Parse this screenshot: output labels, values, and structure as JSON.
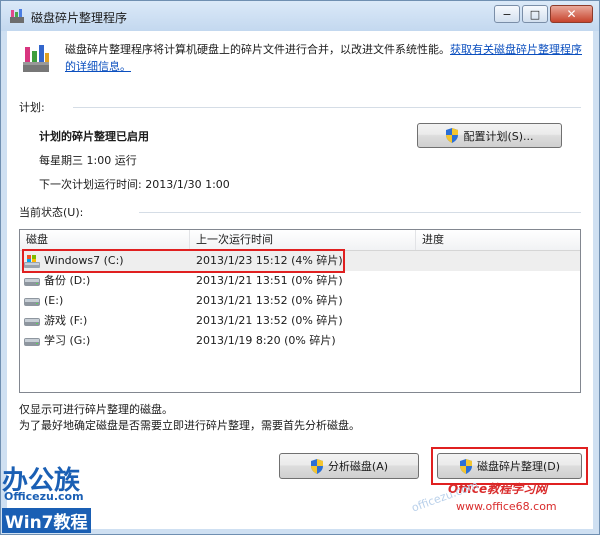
{
  "window": {
    "title": "磁盘碎片整理程序",
    "buttons": {
      "minimize": "−",
      "maximize": "□",
      "close": "✕"
    }
  },
  "intro": {
    "text": "磁盘碎片整理程序将计算机硬盘上的碎片文件进行合并，以改进文件系统性能。",
    "link": "获取有关磁盘碎片整理程序的详细信息。"
  },
  "schedule": {
    "group_label": "计划:",
    "status": "计划的碎片整理已启用",
    "run_time": "每星期三  1:00 运行",
    "next_run": "下一次计划运行时间: 2013/1/30 1:00",
    "configure_button": "配置计划(S)..."
  },
  "current": {
    "group_label": "当前状态(U):",
    "columns": [
      "磁盘",
      "上一次运行时间",
      "进度"
    ],
    "rows": [
      {
        "disk": "Windows7 (C:)",
        "last_run": "2013/1/23 15:12 (4% 碎片)",
        "progress": "",
        "type": "system"
      },
      {
        "disk": "备份 (D:)",
        "last_run": "2013/1/21 13:51 (0% 碎片)",
        "progress": "",
        "type": "drive"
      },
      {
        "disk": "(E:)",
        "last_run": "2013/1/21 13:52 (0% 碎片)",
        "progress": "",
        "type": "drive"
      },
      {
        "disk": "游戏 (F:)",
        "last_run": "2013/1/21 13:52 (0% 碎片)",
        "progress": "",
        "type": "drive"
      },
      {
        "disk": "学习 (G:)",
        "last_run": "2013/1/19 8:20 (0% 碎片)",
        "progress": "",
        "type": "drive"
      }
    ]
  },
  "notes": {
    "line1": "仅显示可进行碎片整理的磁盘。",
    "line2": "为了最好地确定磁盘是否需要立即进行碎片整理，需要首先分析磁盘。"
  },
  "actions": {
    "analyze": "分析磁盘(A)",
    "defrag": "磁盘碎片整理(D)"
  },
  "watermarks": {
    "brand_cn": "办公族",
    "brand_url": "Officezu.com",
    "win7": "Win7教程",
    "right_site": "Office教程学习网",
    "right_url": "www.office68.com",
    "center_mark": "officezu.com"
  },
  "colors": {
    "highlight_box": "#e02020",
    "link": "#0b4fbf",
    "watermark_blue": "#1a5fb4",
    "watermark_red": "#d92b2b"
  }
}
